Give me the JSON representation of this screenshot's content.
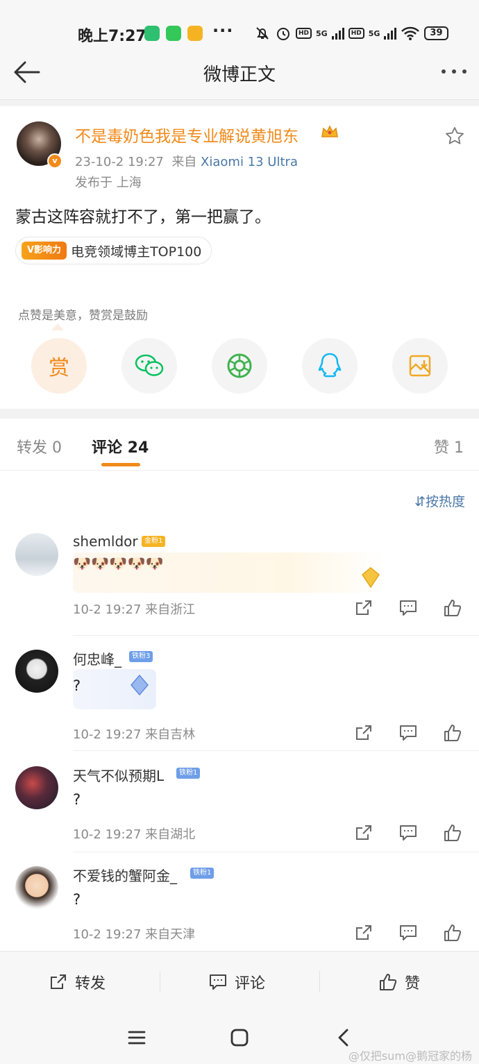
{
  "status_bar": {
    "time": "晚上7:27",
    "more": "···",
    "network1": "5G",
    "network2": "5G",
    "hd1": "HD",
    "hd2": "HD",
    "battery": "39"
  },
  "header": {
    "title": "微博正文"
  },
  "post": {
    "author": "不是毒奶色我是专业解说黄旭东",
    "datetime": "23-10-2 19:27",
    "source_prefix": "来自",
    "device": "Xiaomi 13 Ultra",
    "location": "发布于 上海",
    "text": "蒙古这阵容就打不了，第一把赢了。",
    "influence_logo": "V影响力",
    "influence_label": "电竞领域博主TOP100",
    "tip": "点赞是美意，赞赏是鼓励",
    "reward_label": "赏"
  },
  "tabs": {
    "repost": "转发 0",
    "comment": "评论 24",
    "like": "赞 1"
  },
  "sort_label": "按热度",
  "comments": [
    {
      "name": "shemldor",
      "badge": "金粉1",
      "text": "🐶🐶🐶🐶🐶",
      "time": "10-2 19:27 来自浙江"
    },
    {
      "name": "何忠峰_",
      "badge": "铁粉3",
      "text": "?",
      "time": "10-2 19:27 来自吉林"
    },
    {
      "name": "天气不似预期L",
      "badge": "铁粉1",
      "text": "?",
      "time": "10-2 19:27 来自湖北"
    },
    {
      "name": "不爱钱的蟹阿金_",
      "badge": "铁粉1",
      "text": "?",
      "time": "10-2 19:27 来自天津"
    }
  ],
  "action_bar": {
    "repost": "转发",
    "comment": "评论",
    "like": "赞"
  },
  "watermark": "@仅把sum@鹅冠家的杨",
  "colors": {
    "accent": "#f08a1a",
    "link": "#4a78a8",
    "wechat": "#07c160",
    "qq": "#12b7f5"
  }
}
